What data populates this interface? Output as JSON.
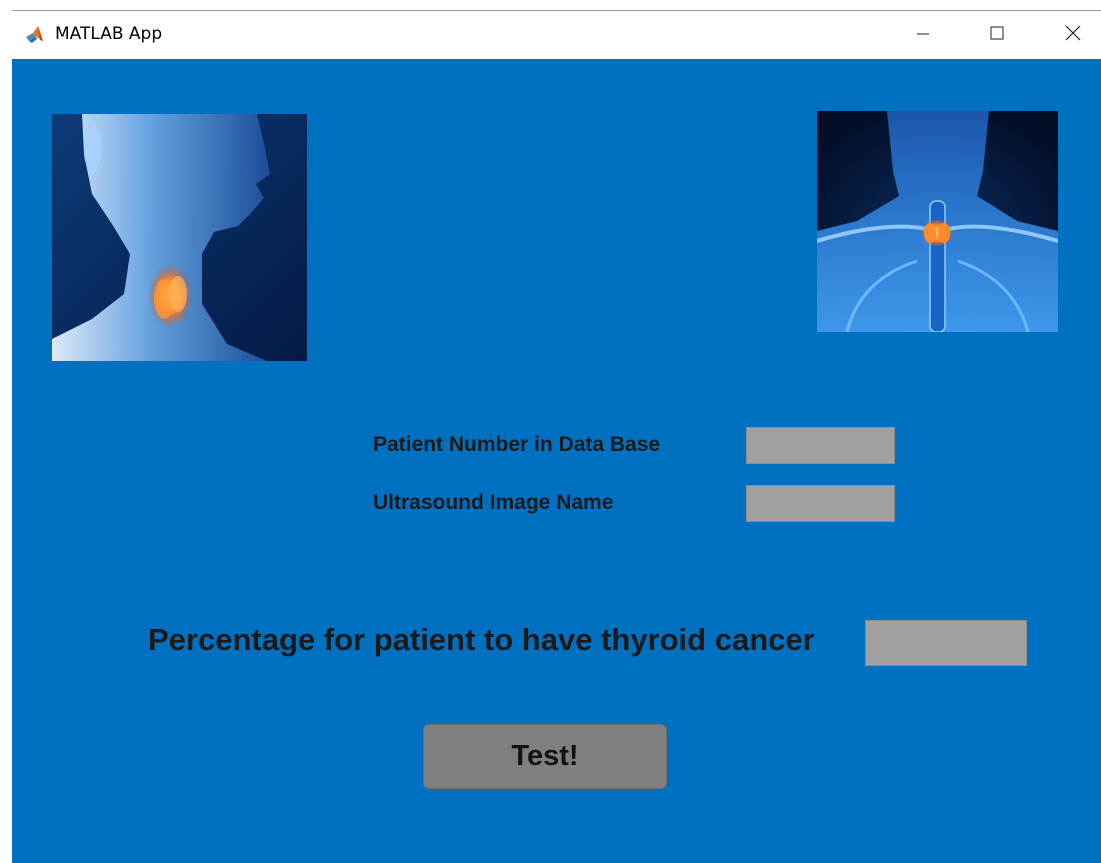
{
  "window": {
    "title": "MATLAB App",
    "icon": "matlab-logo-icon",
    "controls": [
      "minimize-icon",
      "maximize-icon",
      "close-icon"
    ]
  },
  "colors": {
    "background": "#0070c0",
    "field": "#a0a0a0",
    "button": "#7f7f7f",
    "label_text": "#1a1a1a"
  },
  "images": {
    "left": "thyroid-neck-side-view-image",
    "right": "thyroid-neck-front-view-image"
  },
  "form": {
    "patient_label": "Patient Number in Data Base",
    "patient_value": "",
    "ultrasound_label": "Ultrasound Image Name",
    "ultrasound_value": "",
    "percentage_label": "Percentage for patient to have thyroid cancer",
    "percentage_value": ""
  },
  "actions": {
    "test_label": "Test!"
  }
}
